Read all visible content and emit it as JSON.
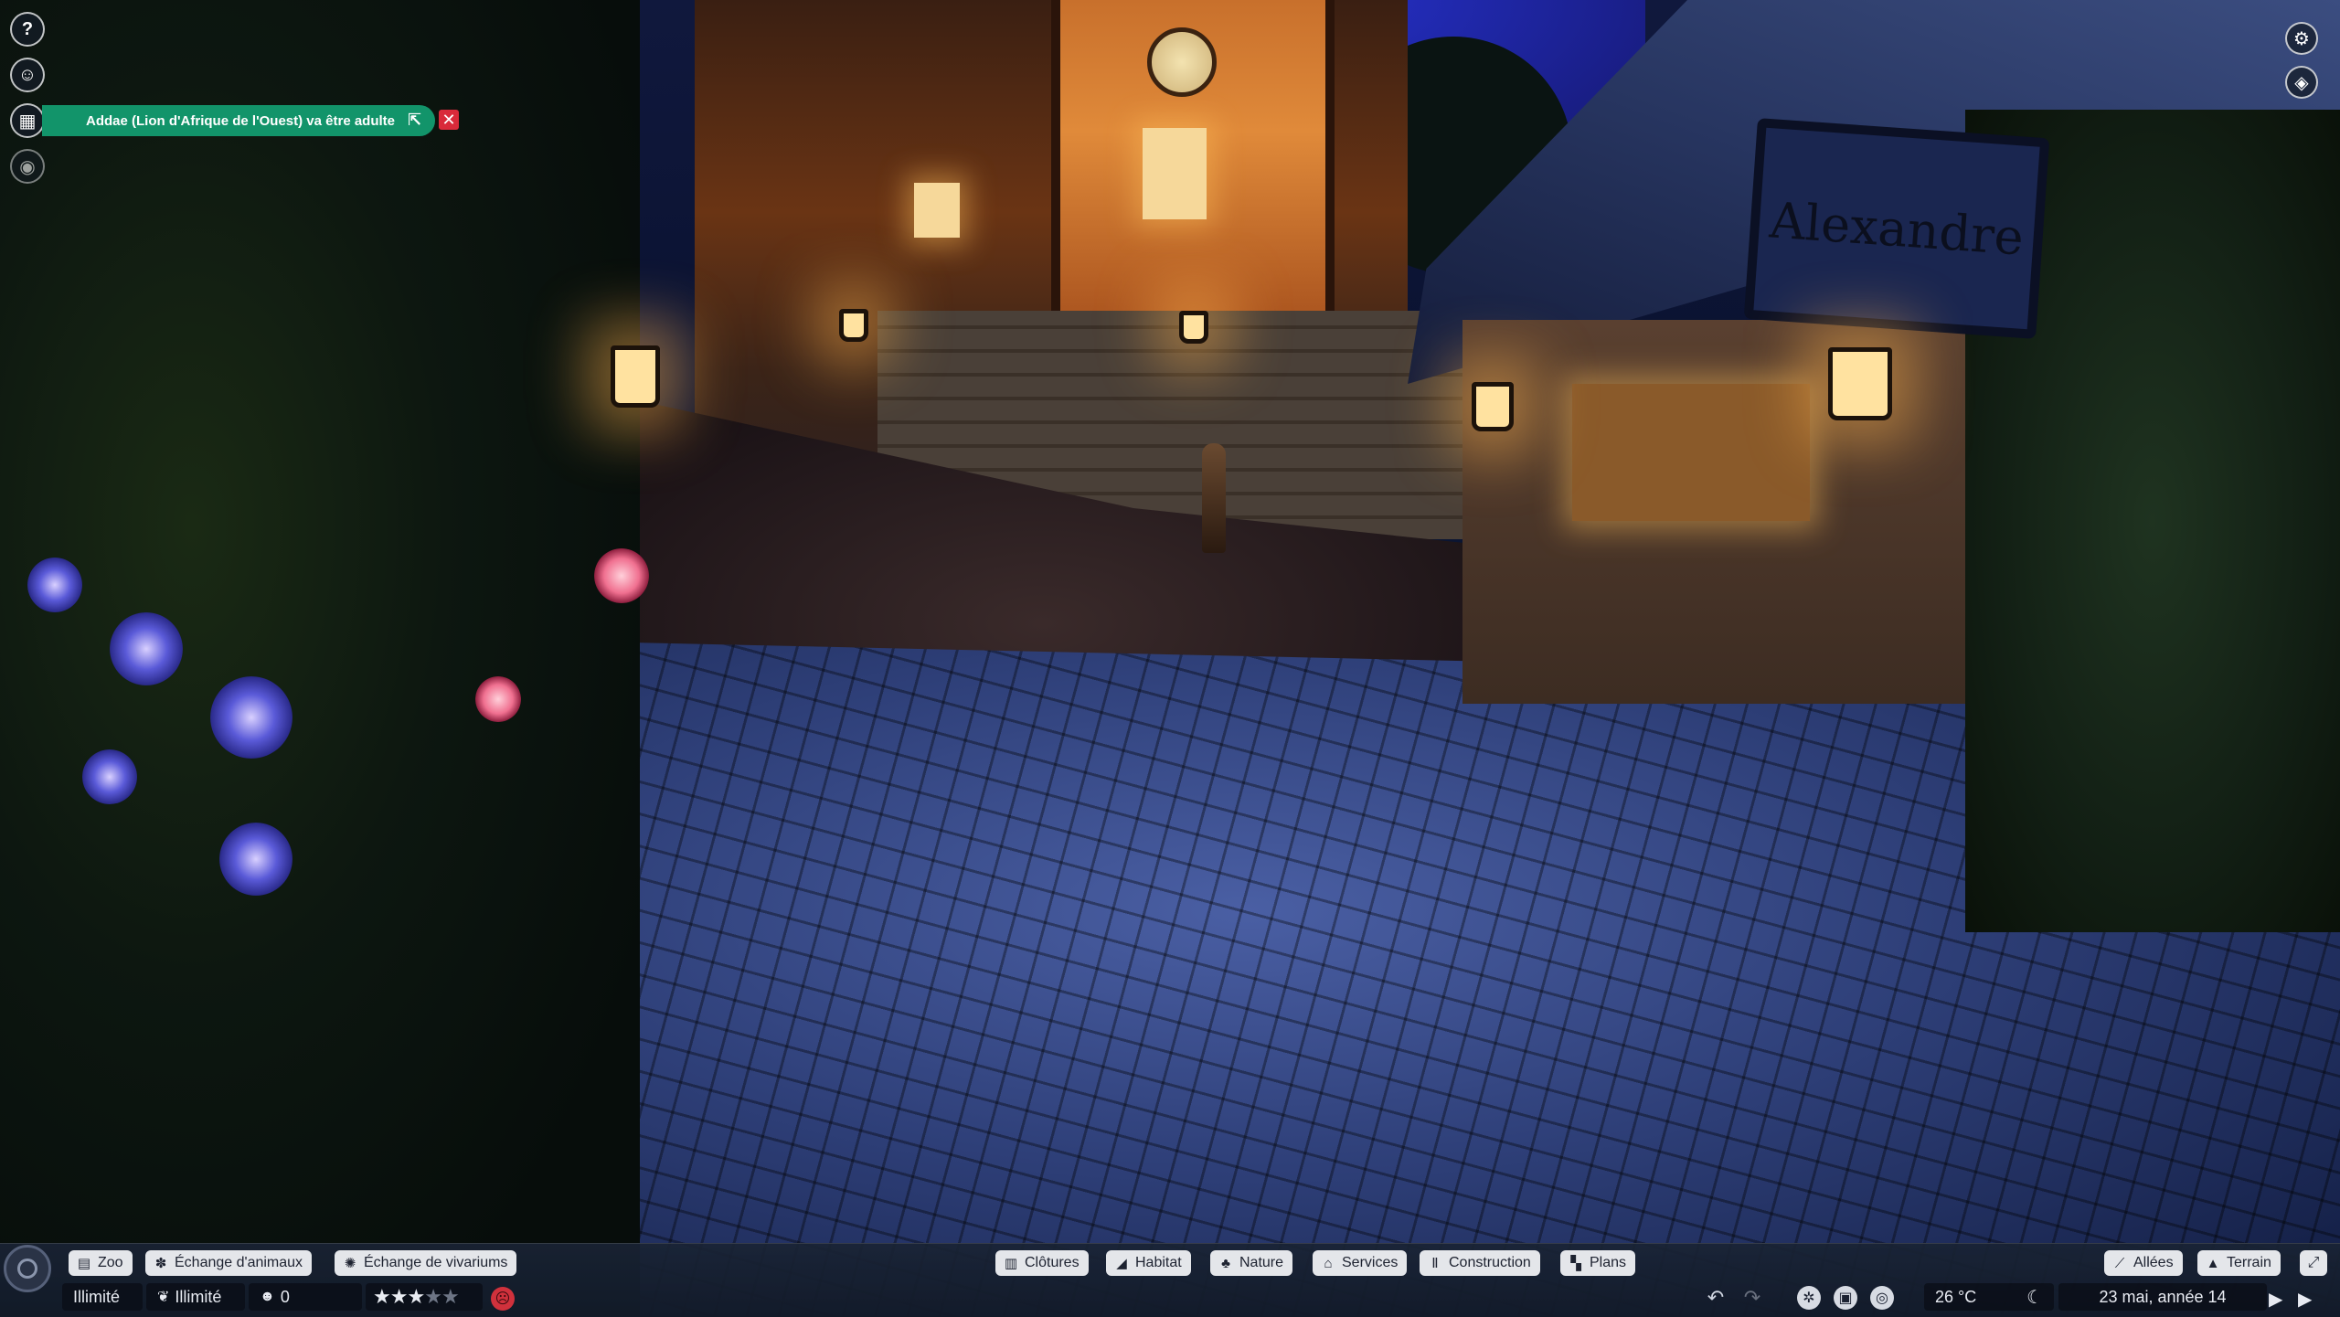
{
  "scene": {
    "shop_sign": "Alexandre"
  },
  "left_toolbar": {
    "help_icon": "question-icon",
    "items": [
      "help",
      "zookeeper",
      "calendar",
      "visibility"
    ]
  },
  "notification": {
    "text": "Addae (Lion d'Afrique de l'Ouest) va être adulte",
    "open_icon": "external-link-icon",
    "close_label": "✕",
    "color": "#12946a",
    "close_color": "#d92a3a"
  },
  "bottom_left_tabs": [
    {
      "label": "Zoo",
      "icon": "list-icon"
    },
    {
      "label": "Échange d'animaux",
      "icon": "paw-icon"
    },
    {
      "label": "Échange de vivariums",
      "icon": "bug-icon"
    }
  ],
  "build_tabs": [
    {
      "label": "Clôtures",
      "icon": "fence-icon"
    },
    {
      "label": "Habitat",
      "icon": "habitat-icon"
    },
    {
      "label": "Nature",
      "icon": "tree-icon"
    },
    {
      "label": "Services",
      "icon": "shop-icon"
    },
    {
      "label": "Construction",
      "icon": "pillar-icon"
    },
    {
      "label": "Plans",
      "icon": "blueprint-icon"
    }
  ],
  "right_tabs": [
    {
      "label": "Allées",
      "icon": "path-icon"
    },
    {
      "label": "Terrain",
      "icon": "terrain-icon"
    }
  ],
  "status": {
    "money": "Illimité",
    "research": "Illimité",
    "guests": "0",
    "rating_stars": 3,
    "rating_max": 5,
    "temperature": "26 °C",
    "date": "23 mai, année 14"
  }
}
